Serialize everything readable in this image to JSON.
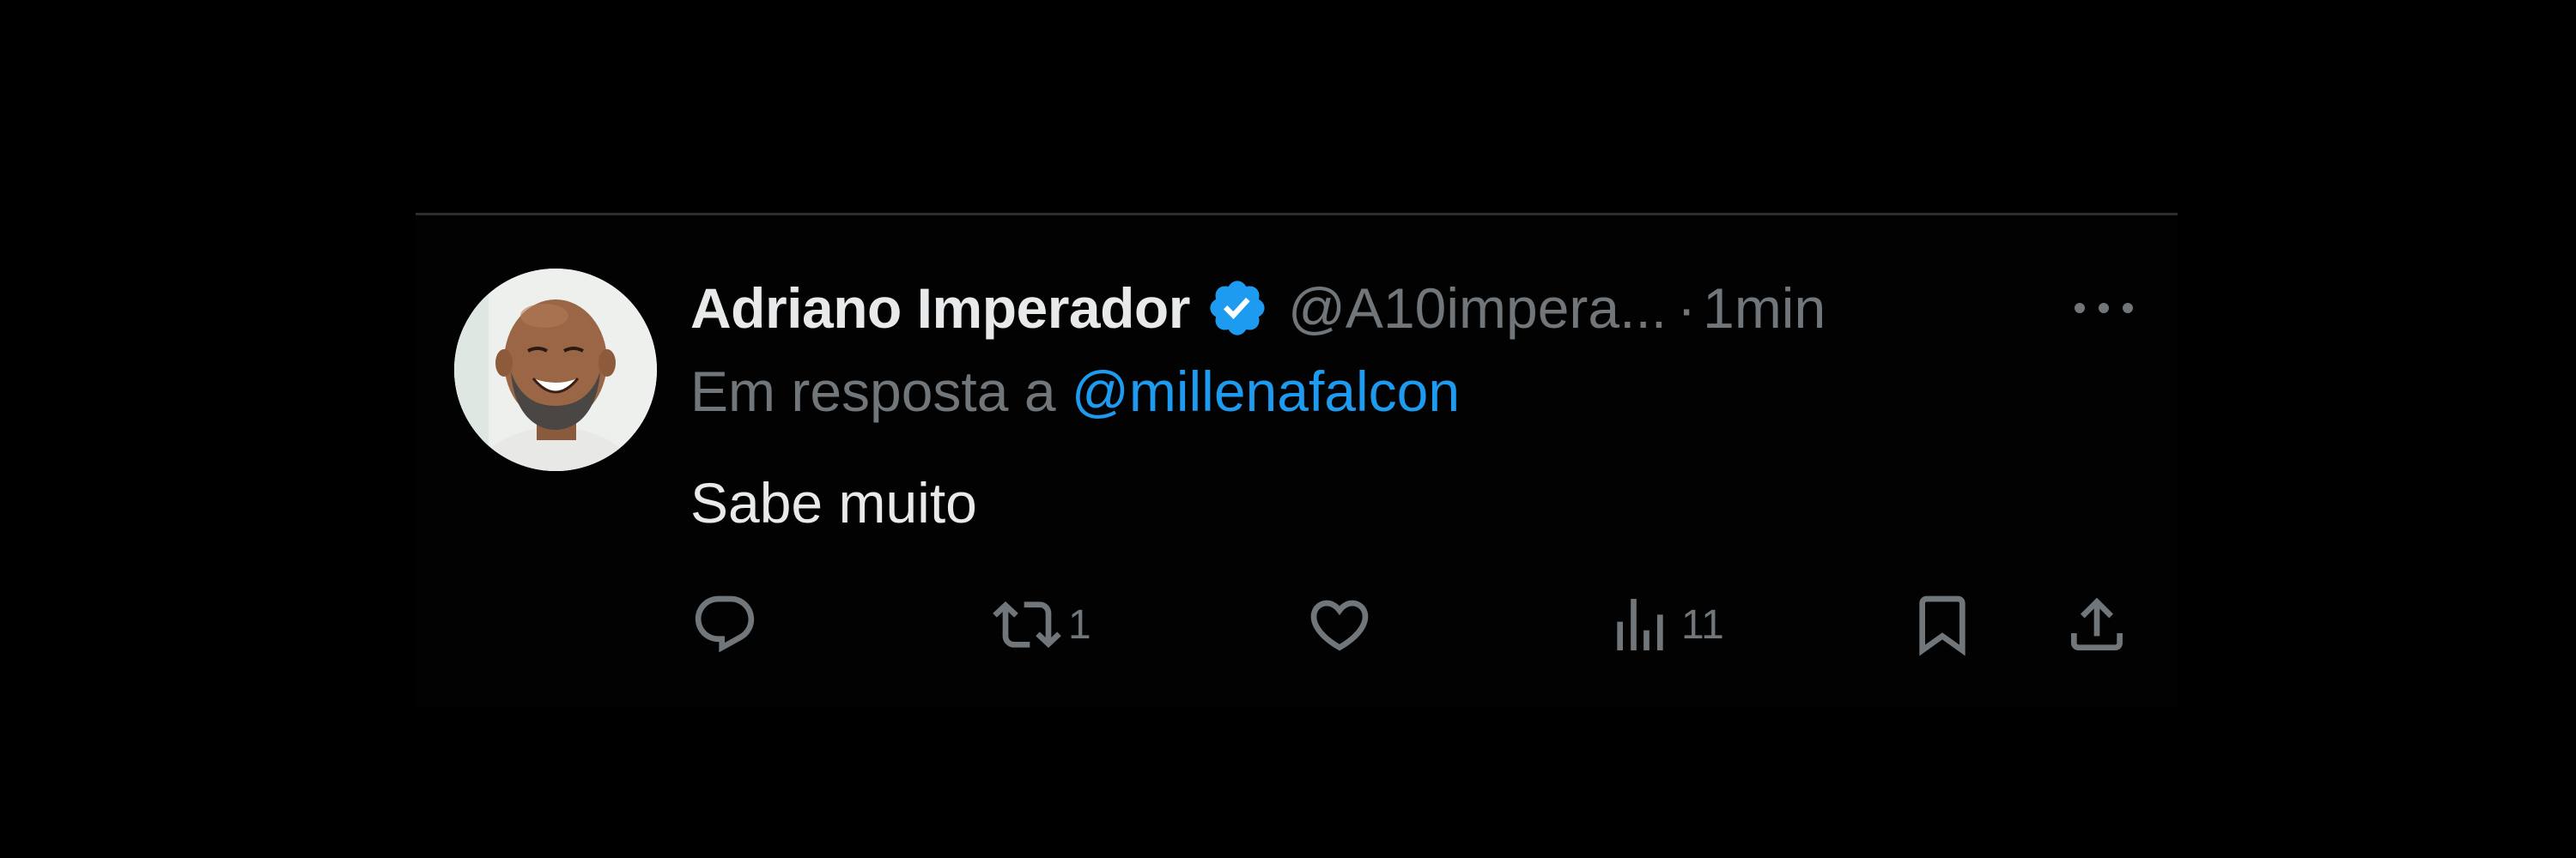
{
  "tweet": {
    "display_name": "Adriano Imperador",
    "handle": "@A10impera...",
    "separator": "·",
    "time": "1min",
    "reply_prefix": "Em resposta a",
    "reply_mention": "@millenafalcon",
    "text": "Sabe muito"
  },
  "actions": {
    "reply": {
      "icon": "reply-icon",
      "count": ""
    },
    "retweet": {
      "icon": "retweet-icon",
      "count": "1"
    },
    "like": {
      "icon": "heart-icon",
      "count": ""
    },
    "views": {
      "icon": "views-icon",
      "count": "11"
    },
    "bookmark": {
      "icon": "bookmark-icon",
      "count": ""
    },
    "share": {
      "icon": "share-icon",
      "count": ""
    }
  },
  "colors": {
    "background": "#000000",
    "primary_text": "#e7e9ea",
    "secondary_text": "#71767b",
    "accent": "#1d9bf0",
    "divider": "#2a2d31"
  }
}
